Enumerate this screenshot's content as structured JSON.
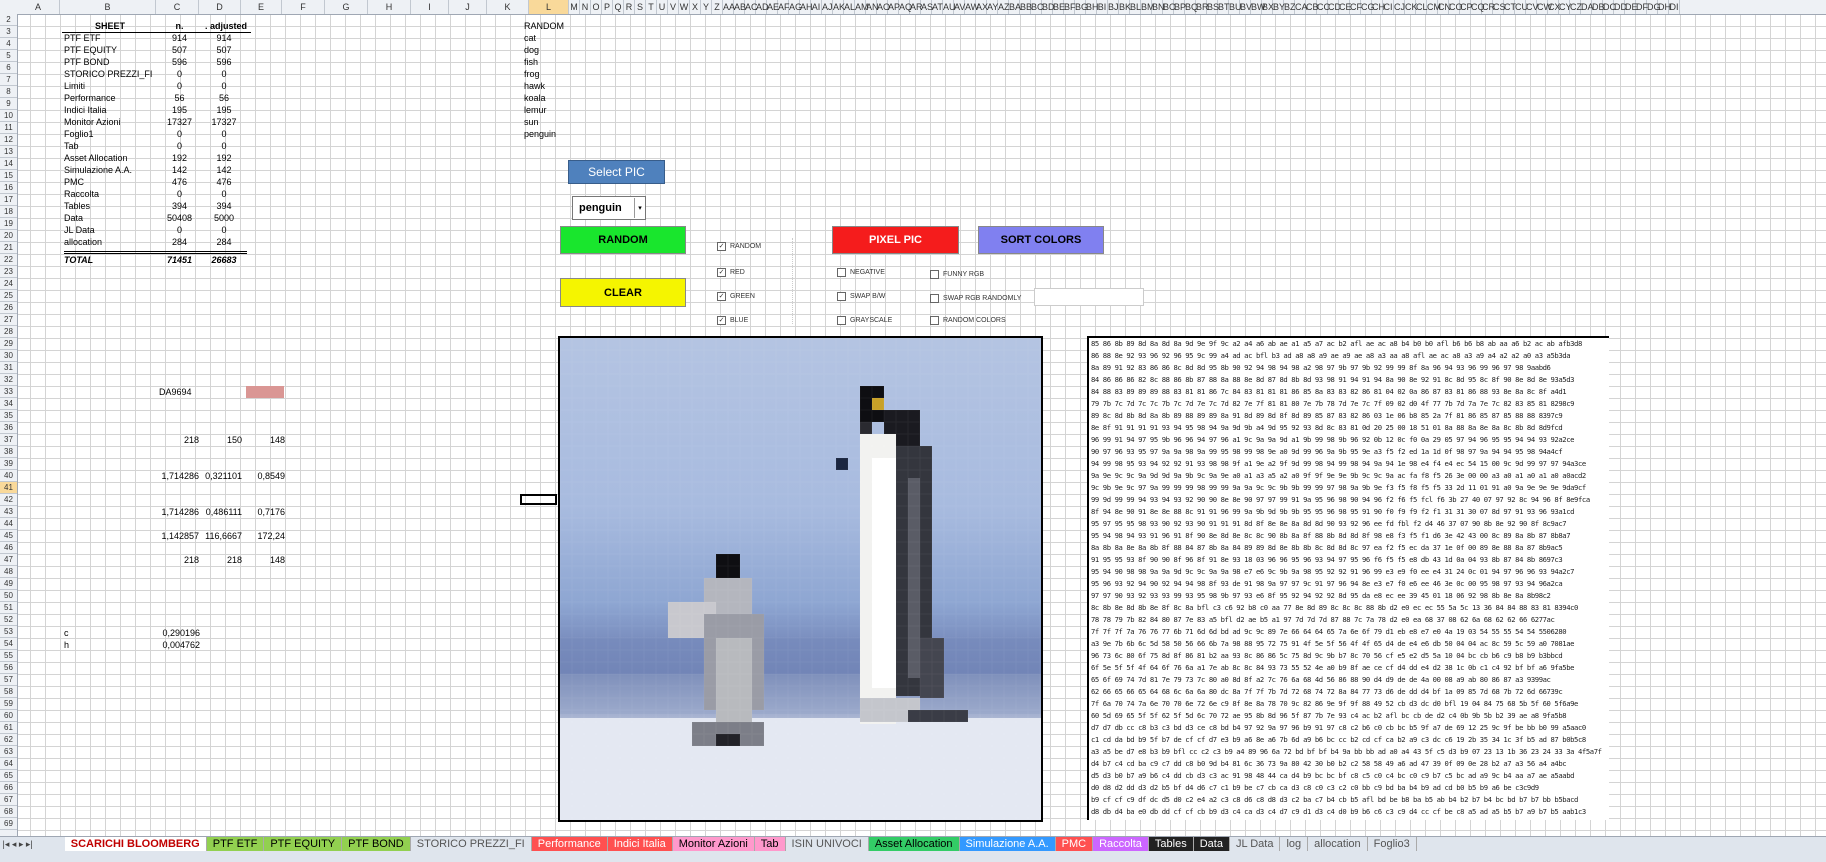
{
  "columns": [
    "A",
    "B",
    "C",
    "D",
    "E",
    "F",
    "G",
    "H",
    "I",
    "J",
    "K",
    "L",
    "M",
    "N",
    "O",
    "P",
    "Q",
    "R",
    "S",
    "T",
    "U",
    "V",
    "W",
    "X",
    "Y",
    "Z",
    "AA",
    "AB",
    "AC",
    "AD",
    "AE",
    "AF",
    "AG",
    "AH",
    "AI",
    "AJ",
    "AK",
    "AL",
    "AM",
    "AN",
    "AO",
    "AP",
    "AQ",
    "AR",
    "AS",
    "AT",
    "AU",
    "AV",
    "AW",
    "AX",
    "AY",
    "AZ",
    "BA",
    "BB",
    "BC",
    "BD",
    "BE",
    "BF",
    "BG",
    "BH",
    "BI",
    "BJ",
    "BK",
    "BL",
    "BM",
    "BN",
    "BO",
    "BP",
    "BQ",
    "BR",
    "BS",
    "BT",
    "BU",
    "BV",
    "BW",
    "BX",
    "BY",
    "BZ",
    "CA",
    "CB",
    "CC",
    "CD",
    "CE",
    "CF",
    "CG",
    "CH",
    "CI",
    "CJ",
    "CK",
    "CL",
    "CM",
    "CN",
    "CO",
    "CP",
    "CQ",
    "CR",
    "CS",
    "CT",
    "CU",
    "CV",
    "CW",
    "CX",
    "CY",
    "CZ",
    "DA",
    "DB",
    "DC",
    "DD",
    "DE",
    "DF",
    "DG",
    "DH",
    "DI"
  ],
  "rows": [
    "2",
    "3",
    "4",
    "5",
    "6",
    "7",
    "8",
    "9",
    "10",
    "11",
    "12",
    "13",
    "14",
    "15",
    "16",
    "17",
    "18",
    "19",
    "20",
    "21",
    "22",
    "23",
    "24",
    "25",
    "26",
    "27",
    "28",
    "29",
    "30",
    "31",
    "32",
    "33",
    "34",
    "35",
    "36",
    "37",
    "38",
    "39",
    "40",
    "41",
    "42",
    "43",
    "44",
    "45",
    "46",
    "47",
    "48",
    "49",
    "50",
    "51",
    "52",
    "53",
    "54",
    "55",
    "56",
    "57",
    "58",
    "59",
    "60",
    "61",
    "62",
    "63",
    "64",
    "65",
    "66",
    "67",
    "68",
    "69"
  ],
  "summary": {
    "header_sheet": "SHEET",
    "header_n": "n.",
    "header_adjusted": ". adjusted",
    "rows": [
      {
        "name": "PTF ETF",
        "n": "914",
        "adj": "914"
      },
      {
        "name": "PTF EQUITY",
        "n": "507",
        "adj": "507"
      },
      {
        "name": "PTF BOND",
        "n": "596",
        "adj": "596"
      },
      {
        "name": "STORICO PREZZI_FI",
        "n": "0",
        "adj": "0"
      },
      {
        "name": "Limiti",
        "n": "0",
        "adj": "0"
      },
      {
        "name": "Performance",
        "n": "56",
        "adj": "56"
      },
      {
        "name": "Indici Italia",
        "n": "195",
        "adj": "195"
      },
      {
        "name": "Monitor Azioni",
        "n": "17327",
        "adj": "17327"
      },
      {
        "name": "Foglio1",
        "n": "0",
        "adj": "0"
      },
      {
        "name": "Tab",
        "n": "0",
        "adj": "0"
      },
      {
        "name": "Asset Allocation",
        "n": "192",
        "adj": "192"
      },
      {
        "name": "Simulazione A.A.",
        "n": "142",
        "adj": "142"
      },
      {
        "name": "PMC",
        "n": "476",
        "adj": "476"
      },
      {
        "name": "Raccolta",
        "n": "0",
        "adj": "0"
      },
      {
        "name": "Tables",
        "n": "394",
        "adj": "394"
      },
      {
        "name": "Data",
        "n": "50408",
        "adj": "5000"
      },
      {
        "name": "JL Data",
        "n": "0",
        "adj": "0"
      },
      {
        "name": "allocation",
        "n": "284",
        "adj": "284"
      }
    ],
    "total_label": "TOTAL",
    "total_n": "71451",
    "total_adj": "26683"
  },
  "calc": {
    "color_code": "DA9694",
    "swatch_color": "#da9694",
    "r36": [
      "218",
      "150",
      "148"
    ],
    "r39": [
      "1,714286",
      "0,321101",
      "0,8549"
    ],
    "r42": [
      "1,714286",
      "0,486111",
      "0,7176"
    ],
    "r44": [
      "1,142857",
      "116,6667",
      "172,24"
    ],
    "r46": [
      "218",
      "218",
      "148"
    ],
    "c_label": "c",
    "c_value": "0,290196",
    "h_label": "h",
    "h_value": "0,004762"
  },
  "random_list": {
    "header": "RANDOM",
    "items": [
      "cat",
      "dog",
      "fish",
      "frog",
      "hawk",
      "koala",
      "lemur",
      "sun",
      "penguin"
    ]
  },
  "controls": {
    "select_pic": "Select PIC",
    "dropdown_value": "penguin",
    "random": "RANDOM",
    "clear": "CLEAR",
    "pixel_pic": "PIXEL PIC",
    "sort_colors": "SORT COLORS",
    "chk_random": "RANDOM",
    "chk_red": "RED",
    "chk_green": "GREEN",
    "chk_blue": "BLUE",
    "chk_negative": "NEGATIVE",
    "chk_swap_bw": "SWAP B/W",
    "chk_grayscale": "GRAYSCALE",
    "chk_funny_rgb": "FUNNY RGB",
    "chk_swap_rgb": "SWAP RGB RANDOMLY",
    "chk_random_colors": "RANDOM COLORS",
    "colors": {
      "random_btn": "#19e62d",
      "clear_btn": "#f5f500",
      "pixel_btn": "#f51c1c",
      "sort_btn": "#8080f0",
      "select_btn": "#4f81bd"
    }
  },
  "hex_rows": [
    "85 86 8b 89 8d 8a 8d 8a 9d 9e 9f 9c a2 a4 a6 ab ae a1 a5 a7 ac b2 afl ae ac a8 b4 b0 b0 afl b6 b6 b8 ab aa a6 b2 ac ab afb3d8",
    "86 88 8e 92 93 96 92 96 95 9c 99 a4 ad ac bfl b3 ad a8 a8 a9 ae a9 ae a8 a3 aa a8 afl ae ac a8 a3 a9 a4 a2 a2 a0 a3 a5b3da",
    "8a 89 91 92 83 86 86 8c 8d 8d 95 8b 90 92 94 98 94 98 a2 98 97 9b 97 9b 92 99 99 8f 8a 96 94 93 96 99 96 97 98 9aabd6",
    "84 86 86 86 82 8c 88 86 8b 87 88 8a 88 8e 8d 87 8d 8b 8d 93 98 91 94 91 94 8a 90 8e 92 91 8c 8d 95 8c 8f 90 8e 8d 8e 93a5d3",
    "84 88 83 89 89 89 88 83 81 81 86 7c 84 83 81 81 81 86 85 8a 83 83 82 86 81 04 02 0a 86 87 83 81 86 88 93 8e 8a 8c 8f a4d1",
    "79 7b 7c 7d 7c 7c 7b 7c 7d 7e 7c 7d 82 7e 7f 81 81 80 7e 7b 78 7d 7e 7c 7f 09 02 d0 4f 77 7b 7d 7a 7e 7c 82 83 85 81 8298c9",
    "89 8c 8d 8b 8d 8a 8b 89 88 89 89 8a 91 8d 89 8d 8f 8d 89 85 87 83 82 86 03 1e 06 b8 85 2a 7f 81 86 85 87 85 88 88 8397c9",
    "8e 8f 91 91 91 91 93 94 95 98 94 9a 9d 9b a4 9d 95 92 93 8d 8c 83 81 0d 20 25 00 18 51 01 8a 88 8a 8e 8a 8c 8b 8d 8d9fcd",
    "96 99 91 94 97 95 9b 96 96 94 97 96 a1 9c 9a 9a 9d a1 9b 99 98 9b 96 92 0b 12 0c f0 0a 29 05 97 94 96 95 95 94 94 93 92a2ce",
    "90 97 96 93 95 97 9a 9a 98 9a 99 95 98 99 98 9e a0 9d 99 96 9a 9b 95 9e a3 f5 f2 ed 1a 1d 0f 98 97 9a 94 94 95 98 94a4cf",
    "94 99 98 95 93 94 92 92 91 93 98 98 9f a1 9e a2 9f 9d 99 98 94 99 98 94 9a 94 1e 98 e4 f4 e4 ec 54 15 00 9c 9d 99 97 97 94a3ce",
    "9a 9e 9c 9c 9a 9d 9d 9a 9b 9c 9a 9e a0 a1 a3 a5 a2 a0 9f 9f 9e 9e 9b 9c 9c 9a ac fa f8 f5 26 3e 00 00 a3 a0 a1 a0 a1 a0 a0acd2",
    "9c 9b 9e 9c 97 9a 99 99 99 98 99 99 9a 9a 9c 9c 9b 9b 99 99 97 98 9a 9b 9e f3 f5 f8 f5 f5 33 2d 11 01 91 a0 9a 9e 9e 9e 9da9cf",
    "99 9d 99 99 94 93 94 93 92 90 90 8e 8e 90 97 97 99 91 9a 95 96 98 90 94 96 f2 f6 f5 fcl f6 3b 27 40 07 97 92 8c 94 96 8f 8e9fca",
    "8f 94 8e 90 91 8e 8e 88 8c 91 91 96 99 9a 9b 9d 9b 9b 95 95 96 98 95 91 90 f0 f9 f9 f2 f1 31 31 30 07 8d 97 91 93 96 93a1cd",
    "95 97 95 95 98 93 90 92 93 90 91 91 91 8d 8f 8e 8e 8a 8d 8d 90 93 92 96 ee fd fbl f2 d4 46 37 07 90 8b 8e 92 90 8f 8c9ac7",
    "95 94 98 94 93 91 96 91 8f 90 8e 8d 8e 8c 8c 90 8b 8a 8f 88 8b 8d 8d 8f 98 e8 f3 f5 f1 d6 3e 42 43 00 8c 89 8a 8b 87 8b8a7",
    "8a 8b 8a 8e 8a 8b 8f 88 84 87 8b 8a 84 89 89 8d 8e 8b 8b 8c 8d 8d 8c 97 ea f2 f5 ec da 37 1e 0f 00 89 8e 88 8a 87 8b9ac5",
    "91 95 95 93 8f 90 90 8f 96 8f 91 8e 93 18 03 96 96 95 96 93 94 97 95 96 f6 f5 f5 e8 db 43 1d 0a 04 93 8b 87 84 8b 8697c3",
    "95 94 90 98 98 9a 9a 9d 9c 9c 9a 9a 98 e7 e6 9c 9b 9a 98 95 92 92 91 96 99 e3 e9 f0 ee e4 31 24 0c 01 94 97 96 96 93 94a2c7",
    "95 96 93 92 94 90 92 94 94 98 8f 93 de 91 98 9a 97 97 9c 91 97 96 94 8e e3 e7 f0 e6 ee 46 3e 0c 00 95 98 97 93 94 96a2ca",
    "97 97 90 93 92 93 93 99 93 95 98 9b 97 93 e6 8f 95 92 94 92 92 8d 95 da e8 ec ee 39 45 01 18 06 92 98 8b 8e 8a 8b98c2",
    "8c 8b 8e 8d 8b 8e 8f 8c 8a bfl c3 c6 92 b8 c0 aa 77 8e 8d 89 8c 8c 8c 88 8b d2 e0 ec ec 55 5a 5c 13 36 84 84 88 83 81 8394c0",
    "78 78 79 7b 82 84 80 87 7e 83 a5 bfl d2 ae b5 a1 97 7d 7d 7d 87 88 7c 7a 78 d2 e0 ea 68 37 08 62 6a 68 62 62 66 6277ac",
    "7f 7f 7f 7a 76 76 77 6b 71 6d 6d bd ad 9c 9c 89 7e 66 64 64 65 7a 6e 6f 79 d1 eb e8 e7 e0 4a 19 03 54 55 55 54 54 5506280",
    "a3 9e 7b 6b 6c 5d 58 50 56 66 6b 7a 98 88 95 72 75 91 4f 5e 5f 56 4f 4f 65 d4 de e4 e6 db 50 04 04 ac 8c 59 5c 59 a0 7081ae",
    "96 73 6c 80 6f 75 8d 8f 86 81 b2 aa 93 8c 86 86 5c 75 8d 9c 9b b7 8c 70 56 cf e5 e2 d5 5a 10 04 bc cb b6 c9 b8 b9 b3bbcd",
    "6f 5e 5f 5f 4f 64 6f 76 6a a1 7e ab 8c 8c 84 93 73 55 52 4e a0 b9 8f ae ce cf d4 dd e4 d2 38 1c 0b c1 c4 92 bf bf a6 9fa5be",
    "65 6f 69 74 7d 81 7e 79 73 7c 80 a0 8d 8f a2 7c 76 6a 68 4d 56 86 88 90 d4 d9 de de 4a 00 08 a9 ab 80 86 87 a3 9399ac",
    "62 66 65 66 65 64 68 6c 6a 6a 80 dc 8a 7f 7f 7b 7d 72 68 74 72 8a 84 77 73 d6 de dd d4 bf 1a 09 85 7d 68 7b 72 6d 66739c",
    "7f 6a 70 74 7a 6e 70 70 6e 72 6e c9 8f 8e 8a 78 70 9c 82 86 9e 9f 9f 88 49 52 cb d3 dc d0 bfl 19 04 84 75 68 5b 5f 60 5f6a9e",
    "60 5d 69 65 5f 5f 62 5f 5d 6c 70 72 ae 95 8b 8d 96 5f 87 7b 7e 93 c4 ac b2 afl bc cb de d2 c4 0b 9b 5b b2 39 ae a8 9fa5b8",
    "d7 d7 db cc c8 b3 c3 bd d3 ce c8 bd b4 97 92 9a 97 96 b9 91 97 c8 c2 b6 c0 cb bc b5 9f a7 de 69 12 25 9c 9f be bb b0 99 a5aac0",
    "c1 cd da bd b9 5f b7 de cf cf d7 e3 b9 a6 8e a6 7b 6d a9 b6 bc cc b2 cd cf ca b2 a9 c3 dc c6 19 2b 35 34 1c 3f b5 ad 87 b0b5c8",
    "a3 a5 be d7 e8 b3 b9 bfl cc c2 c3 b9 a4 89 96 6a 72 bd bf bf b4 9a bb bb ad a0 a4 43 5f c5 d3 b9 07 23 13 1b 36 23 24 33 3a 4f5a7f",
    "d4 b7 c4 cd ba c9 c7 dd c8 b0 9d b4 81 6c 36 73 9a 80 42 30 b0 b2 c2 58 58 49 a6 ad 47 39 0f 09 0e 28 b2 a7 a3 56 a4 a4bc",
    "d5 d3 b0 b7 a9 b6 c4 dd cb d3 c3 ac 91 98 48 44 ca d4 b9 bc bc bf c8 c5 c0 c4 bc c0 c9 b7 c5 bc ad a9 9c b4 aa a7 ae a5aabd",
    "d0 d8 d2 dd d3 d2 b5 bf d4 d6 c7 c1 b9 be c7 cb ca d3 c8 c0 c3 c2 c0 bb c9 bd ba b4 b9 ad cd b0 b5 b9 a6 be c3c9d9",
    "b9 cf cf c9 df dc d5 d0 c2 e4 a2 c3 c8 d6 c8 d8 d3 c2 ba c7 b4 cb b5 afl bd be b8 ba b5 ab b4 b2 b7 b4 bc bd b7 b7 bb b5bacd",
    "d8 db d4 ba e0 db dd cf cf cb b9 d3 c4 ca d3 c4 d7 c9 d1 d3 c4 d0 b9 b6 c6 c3 c9 d4 cc cf be c8 a5 ad a5 b5 b7 a9 b7 b5 aab1c3"
  ],
  "tabs": [
    {
      "label": "SCARICHI BLOOMBERG",
      "color": "#ffffff",
      "active": true,
      "textcolor": "#c00000"
    },
    {
      "label": "PTF ETF",
      "color": "#92d050",
      "active": false,
      "textcolor": "#000"
    },
    {
      "label": "PTF EQUITY",
      "color": "#92d050",
      "active": false,
      "textcolor": "#000"
    },
    {
      "label": "PTF BOND",
      "color": "#92d050",
      "active": false,
      "textcolor": "#000"
    },
    {
      "label": "STORICO PREZZI_FI",
      "color": "#dfe5ed",
      "active": false,
      "textcolor": "#555"
    },
    {
      "label": "Performance",
      "color": "#ff5050",
      "active": false,
      "textcolor": "#fff"
    },
    {
      "label": "Indici Italia",
      "color": "#ff5050",
      "active": false,
      "textcolor": "#fff"
    },
    {
      "label": "Monitor Azioni",
      "color": "#ff99cc",
      "active": false,
      "textcolor": "#000"
    },
    {
      "label": "Tab",
      "color": "#ff99cc",
      "active": false,
      "textcolor": "#000"
    },
    {
      "label": "ISIN UNIVOCI",
      "color": "#dfe5ed",
      "active": false,
      "textcolor": "#555"
    },
    {
      "label": "Asset Allocation",
      "color": "#33cc66",
      "active": false,
      "textcolor": "#000"
    },
    {
      "label": "Simulazione A.A.",
      "color": "#3399ff",
      "active": false,
      "textcolor": "#fff"
    },
    {
      "label": "PMC",
      "color": "#ff5050",
      "active": false,
      "textcolor": "#fff"
    },
    {
      "label": "Raccolta",
      "color": "#cc66ff",
      "active": false,
      "textcolor": "#fff"
    },
    {
      "label": "Tables",
      "color": "#222222",
      "active": false,
      "textcolor": "#fff"
    },
    {
      "label": "Data",
      "color": "#222222",
      "active": false,
      "textcolor": "#fff"
    },
    {
      "label": "JL Data",
      "color": "#dfe5ed",
      "active": false,
      "textcolor": "#555"
    },
    {
      "label": "log",
      "color": "#dfe5ed",
      "active": false,
      "textcolor": "#555"
    },
    {
      "label": "allocation",
      "color": "#dfe5ed",
      "active": false,
      "textcolor": "#555"
    },
    {
      "label": "Foglio3",
      "color": "#dfe5ed",
      "active": false,
      "textcolor": "#555"
    }
  ]
}
